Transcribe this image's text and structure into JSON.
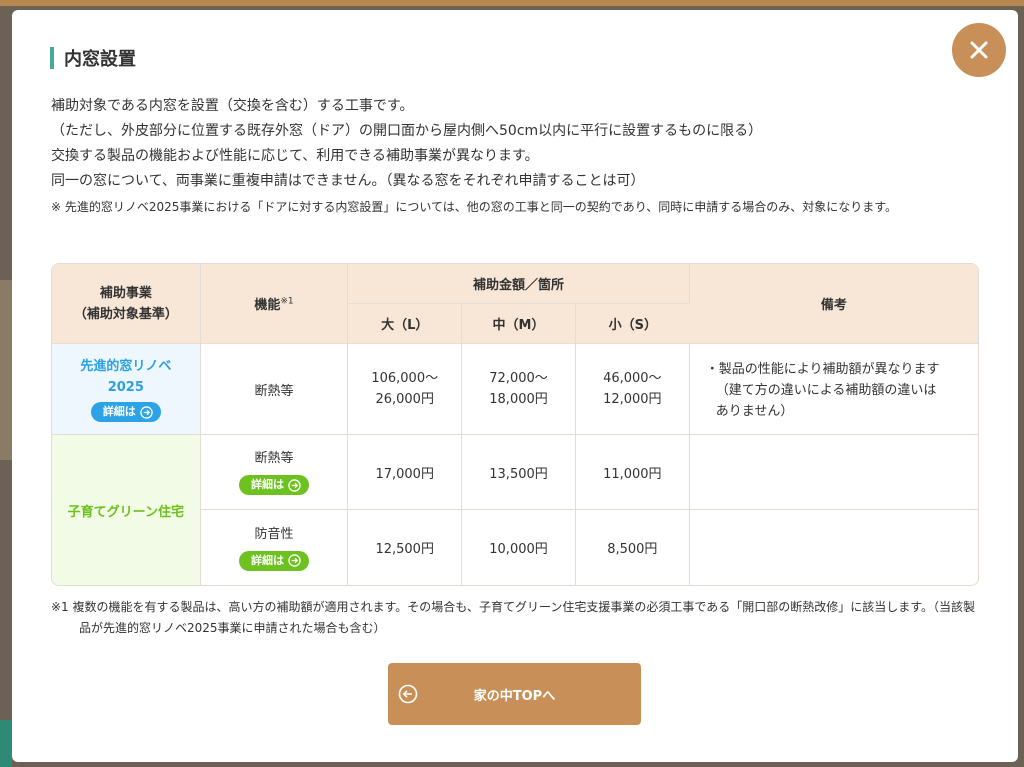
{
  "modal": {
    "title": "内窓設置",
    "close_icon": "close-icon",
    "intro_lines": [
      "補助対象である内窓を設置（交換を含む）する工事です。",
      "（ただし、外皮部分に位置する既存外窓（ドア）の開口面から屋内側へ50cm以内に平行に設置するものに限る）",
      "交換する製品の機能および性能に応じて、利用できる補助事業が異なります。",
      "同一の窓について、両事業に重複申請はできません。（異なる窓をそれぞれ申請することは可）"
    ],
    "note": "※ 先進的窓リノベ2025事業における「ドアに対する内窓設置」については、他の窓の工事と同一の契約であり、同時に申請する場合のみ、対象になります。"
  },
  "table": {
    "headers": {
      "program": "補助事業",
      "program_sub": "（補助対象基準）",
      "function": "機能",
      "function_sup": "※1",
      "amount": "補助金額／箇所",
      "large": "大（L）",
      "medium": "中（M）",
      "small": "小（S）",
      "remarks": "備考"
    },
    "detail_label": "詳細は",
    "rows": {
      "senshin": {
        "program_line1": "先進的窓リノベ",
        "program_line2": "2025",
        "function": "断熱等",
        "large": [
          "106,000〜",
          "26,000円"
        ],
        "medium": [
          "72,000〜",
          "18,000円"
        ],
        "small": [
          "46,000〜",
          "12,000円"
        ],
        "remark_line1": "・製品の性能により補助額が異なります",
        "remark_line2": "（建て方の違いによる補助額の違いは",
        "remark_line3": "ありません）"
      },
      "kosodate": {
        "program": "子育てグリーン住宅",
        "insulation": {
          "function": "断熱等",
          "large": "17,000円",
          "medium": "13,500円",
          "small": "11,000円"
        },
        "soundproof": {
          "function": "防音性",
          "large": "12,500円",
          "medium": "10,000円",
          "small": "8,500円"
        }
      }
    }
  },
  "footnote": "※1  複数の機能を有する製品は、高い方の補助額が適用されます。その場合も、子育てグリーン住宅支援事業の必須工事である「開口部の断熱改修」に該当します。（当該製品が先進的窓リノベ2025事業に申請された場合も含む）",
  "back_button": {
    "label": "家の中TOPへ",
    "icon": "arrow-left-circle-icon"
  },
  "colors": {
    "accent_brown": "#c98f58",
    "title_bar": "#49a897",
    "header_bg": "#f8e7d6",
    "blue": "#2aa1e0",
    "green": "#6cc11d"
  }
}
